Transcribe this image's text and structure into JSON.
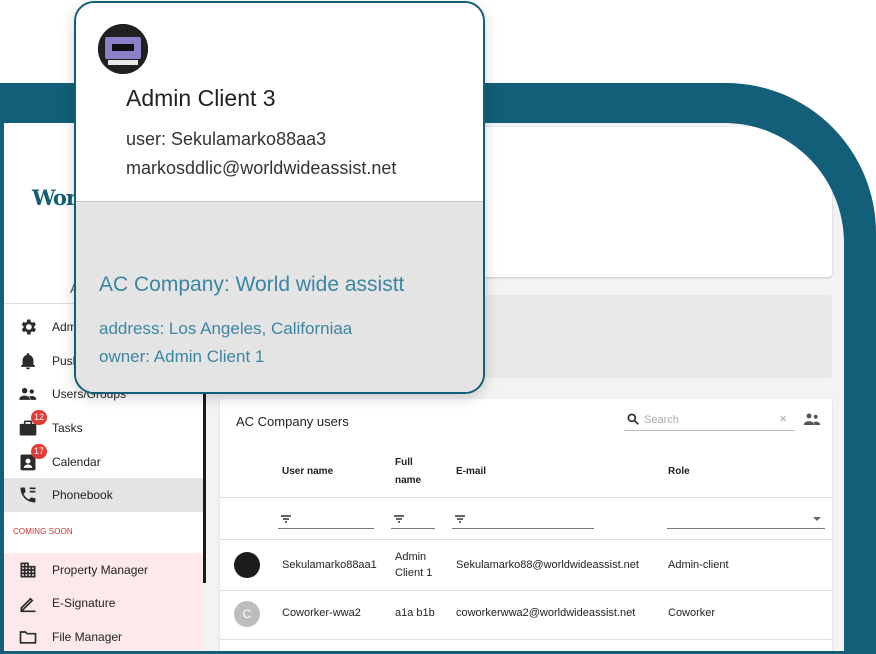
{
  "popover": {
    "name": "Admin Client 3",
    "user_line": "user: Sekulamarko88aa3",
    "email_line": "markosddlic@worldwideassist.net",
    "company_line": "AC Company: World wide assistt",
    "address_line": "address: Los Angeles, Californiaa",
    "owner_line": "owner: Admin Client 1"
  },
  "sidebar": {
    "logo_text": "World",
    "sub_text": "A",
    "items": [
      {
        "label": "Adm",
        "icon": "gear-icon"
      },
      {
        "label": "Push",
        "icon": "bell-icon"
      },
      {
        "label": "Users/Groups",
        "icon": "users-icon"
      },
      {
        "label": "Tasks",
        "icon": "briefcase-icon",
        "badge": "12"
      },
      {
        "label": "Calendar",
        "icon": "calendar-icon",
        "badge": "17"
      },
      {
        "label": "Phonebook",
        "icon": "phonebook-icon",
        "active": true
      }
    ],
    "coming_soon_label": "COMING SOON",
    "soon_items": [
      {
        "label": "Property Manager",
        "icon": "building-icon"
      },
      {
        "label": "E-Signature",
        "icon": "pen-icon"
      },
      {
        "label": "File Manager",
        "icon": "folder-icon"
      }
    ]
  },
  "users_table": {
    "title": "AC Company users",
    "search_placeholder": "Search",
    "clear_symbol": "×",
    "columns": {
      "user_name": "User name",
      "full_name_1": "Full",
      "full_name_2": "name",
      "email": "E-mail",
      "role": "Role"
    },
    "rows": [
      {
        "user_name": "Sekulamarko88aa1",
        "full_name_1": "Admin",
        "full_name_2": "Client 1",
        "email": "Sekulamarko88@worldwideassist.net",
        "role": "Admin-client",
        "avatar_initial": ""
      },
      {
        "user_name": "Coworker-wwa2",
        "full_name_1": "a1a b1b",
        "full_name_2": "",
        "email": "coworkerwwa2@worldwideassist.net",
        "role": "Coworker",
        "avatar_initial": "C"
      }
    ]
  },
  "colors": {
    "frame": "#135e78",
    "accent_text": "#3c86a4",
    "badge": "#e53935",
    "coming_soon": "#d32f2f"
  }
}
